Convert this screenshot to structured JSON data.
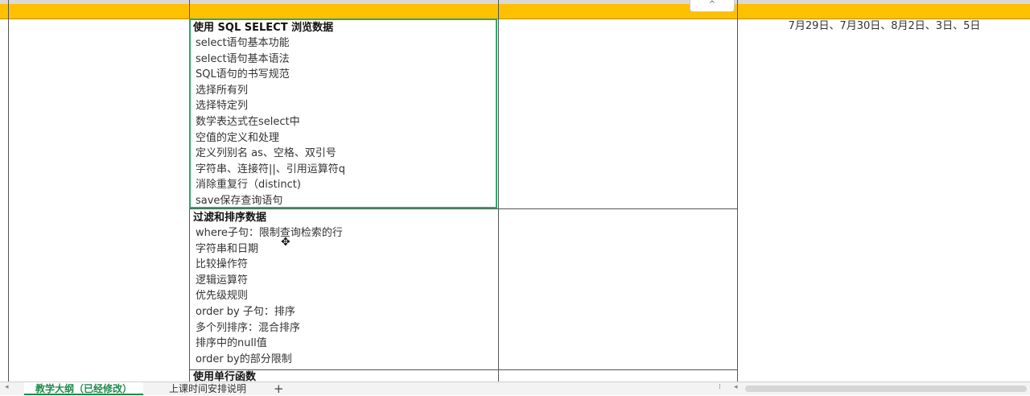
{
  "header": {
    "collapse_symbol": "^"
  },
  "groups": [
    {
      "title": "使用 SQL SELECT 浏览数据",
      "items": [
        "select语句基本功能",
        "select语句基本语法",
        "SQL语句的书写规范",
        "选择所有列",
        "选择特定列",
        "数学表达式在select中",
        "空值的定义和处理",
        "定义列别名 as、空格、双引号",
        "字符串、连接符||、引用运算符q",
        "消除重复行（distinct)",
        "save保存查询语句"
      ]
    },
    {
      "title": "过滤和排序数据",
      "items": [
        "where子句：限制查询检索的行",
        "字符串和日期",
        "比较操作符",
        "逻辑运算符",
        "优先级规则",
        "order by 子句：排序",
        "多个列排序：混合排序",
        "排序中的null值",
        "order by的部分限制"
      ]
    },
    {
      "title": "使用单行函数",
      "items": []
    }
  ],
  "schedule": {
    "dates": "7月29日、7月30日、8月2日、3日、5日"
  },
  "sheet_tabs": {
    "active": "教学大纲（已经修改）",
    "other": "上课时间安排说明",
    "add_symbol": "+"
  },
  "colors": {
    "header_band": "#ffc000",
    "selection": "#2fa56b",
    "active_tab": "#1f8a4c"
  }
}
